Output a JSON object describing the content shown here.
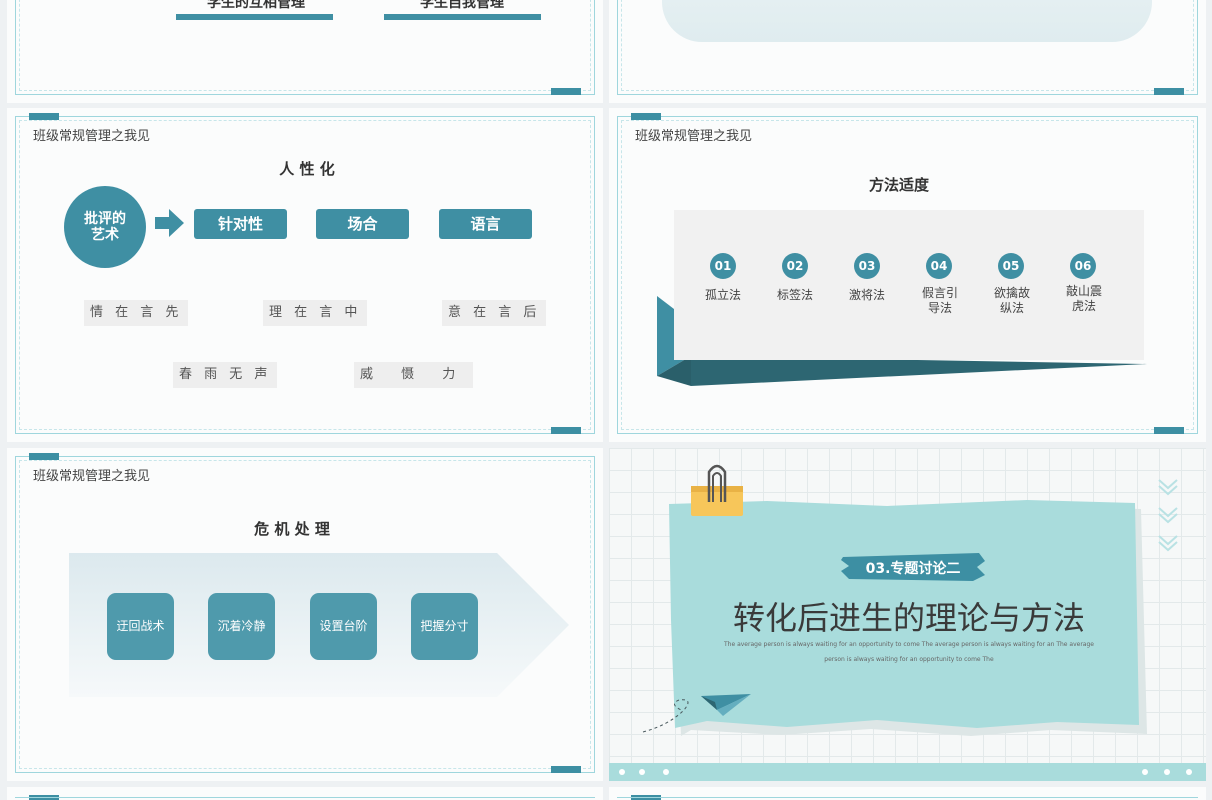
{
  "slide_a": {
    "label_left": "学生的互相管理",
    "label_right": "学生自我管理"
  },
  "slide_c": {
    "title": "班级常规管理之我见",
    "heading": "人 性 化",
    "circle_text": "批评的艺术",
    "pills": [
      "针对性",
      "场合",
      "语言"
    ],
    "tags": [
      "情 在 言 先",
      "理 在 言 中",
      "意 在 言 后",
      "春 雨 无 声",
      "威 慑 力"
    ]
  },
  "slide_d": {
    "title": "班级常规管理之我见",
    "heading": "方法适度",
    "methods": [
      {
        "num": "01",
        "label": "孤立法"
      },
      {
        "num": "02",
        "label": "标签法"
      },
      {
        "num": "03",
        "label": "激将法"
      },
      {
        "num": "04",
        "label": "假言引导法"
      },
      {
        "num": "05",
        "label": "欲擒故纵法"
      },
      {
        "num": "06",
        "label": "敲山震虎法"
      }
    ]
  },
  "slide_e": {
    "title": "班级常规管理之我见",
    "heading": "危 机 处 理",
    "buttons": [
      "迂回战术",
      "沉着冷静",
      "设置台阶",
      "把握分寸"
    ]
  },
  "slide_f": {
    "badge": "03.专题讨论二",
    "heading": "转化后进生的理论与方法",
    "sub_line1": "The average person is always waiting for an opportunity to come The average person is always waiting for an The average",
    "sub_line2": "person is always waiting for an opportunity to come The"
  },
  "colors": {
    "accent": "#3f8fa3",
    "dark_accent": "#2d6672",
    "mint": "#a9dcdc",
    "border": "#9fd6dd"
  }
}
